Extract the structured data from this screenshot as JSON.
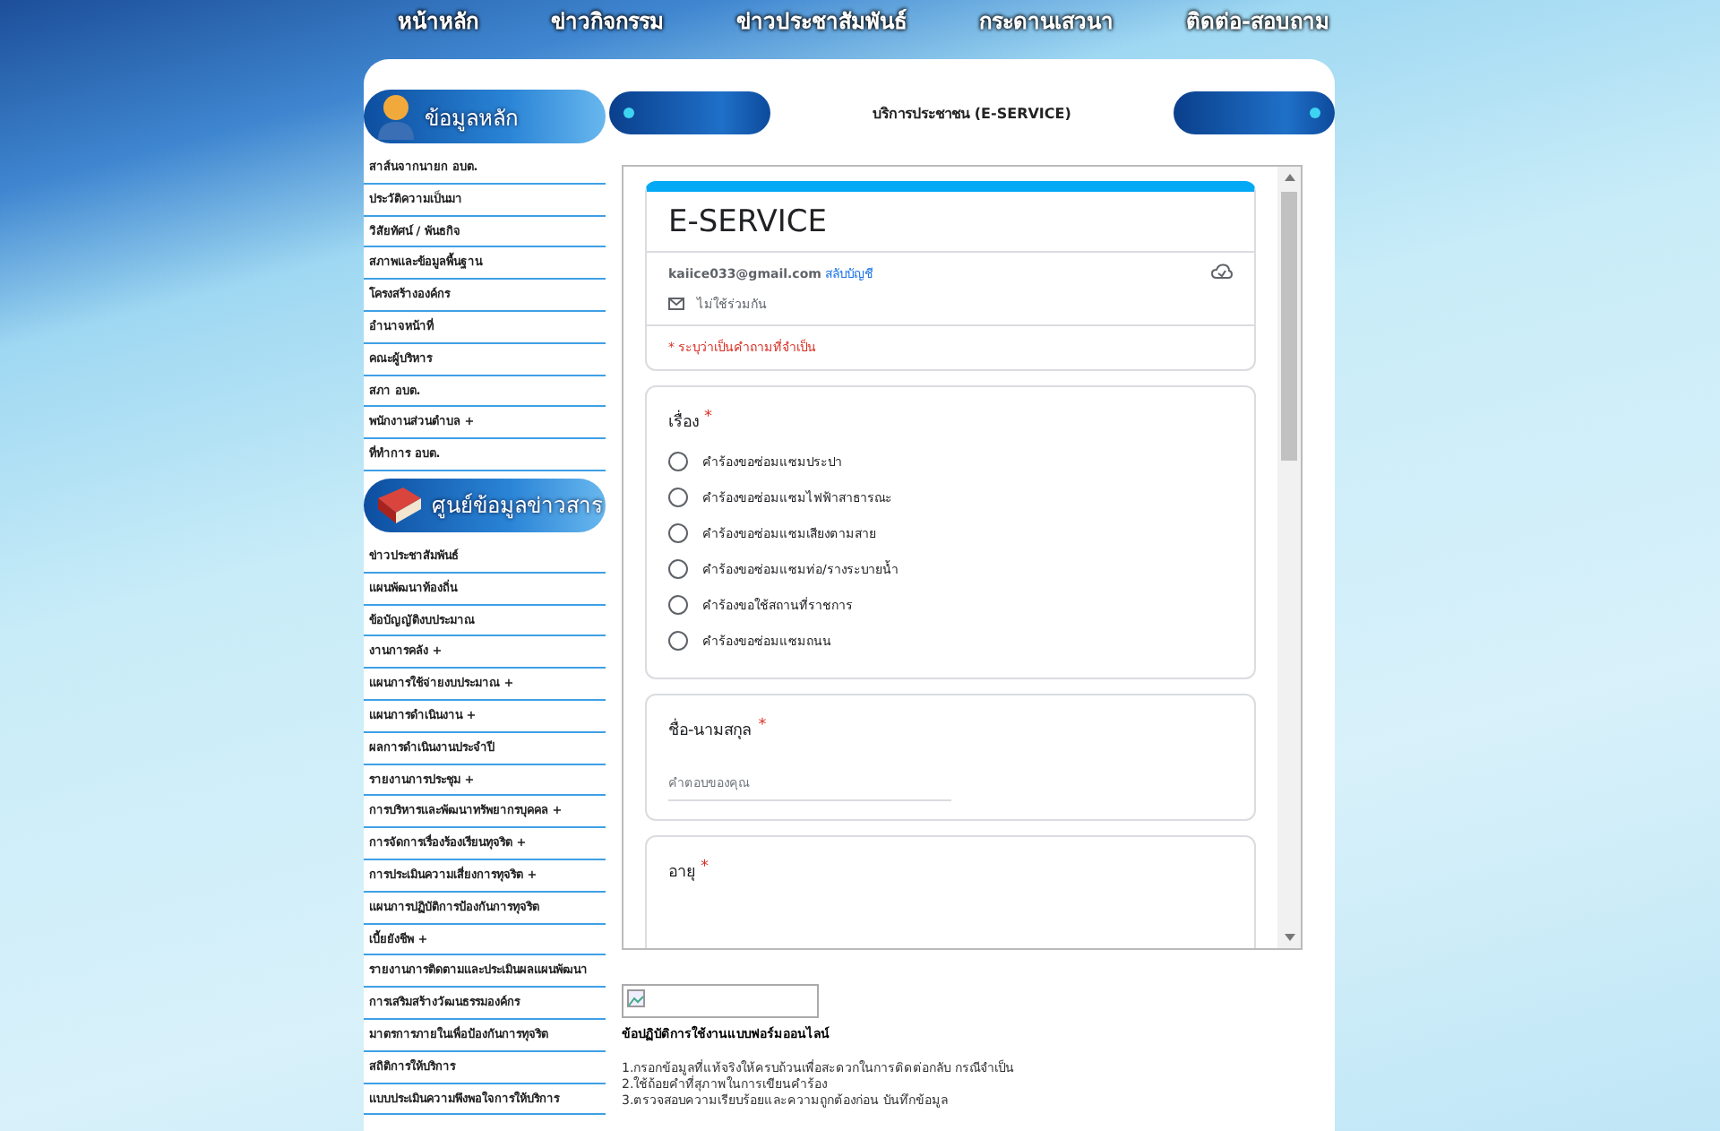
{
  "nav": [
    "หน้าหลัก",
    "ข่าวกิจกรรม",
    "ข่าวประชาสัมพันธ์",
    "กระดานเสวนา",
    "ติดต่อ-สอบถาม"
  ],
  "sidebar": {
    "sections": [
      {
        "title": "ข้อมูลหลัก",
        "kind": "person",
        "items": [
          "สาส์นจากนายก อบต.",
          "ประวัติความเป็นมา",
          "วิสัยทัศน์ / พันธกิจ",
          "สภาพและข้อมูลพื้นฐาน",
          "โครงสร้างองค์กร",
          "อำนาจหน้าที่",
          "คณะผู้บริหาร",
          "สภา อบต.",
          "พนักงานส่วนตำบล +",
          "ที่ทำการ อบต."
        ]
      },
      {
        "title": "ศูนย์ข้อมูลข่าวสาร",
        "kind": "book",
        "items": [
          "ข่าวประชาสัมพันธ์",
          "แผนพัฒนาท้องถิ่น",
          "ข้อบัญญัติงบประมาณ",
          "งานการคลัง +",
          "แผนการใช้จ่ายงบประมาณ +",
          "แผนการดำเนินงาน +",
          "ผลการดำเนินงานประจำปี",
          "รายงานการประชุม +",
          "การบริหารและพัฒนาทรัพยากรบุคคล +",
          "การจัดการเรื่องร้องเรียนทุจริต +",
          "การประเมินความเสี่ยงการทุจริต +",
          "แผนการปฏิบัติการป้องกันการทุจริต",
          "เบี้ยยังชีพ +",
          "รายงานการติดตามและประเมินผลแผนพัฒนา",
          "การเสริมสร้างวัฒนธรรมองค์กร",
          "มาตรการภายในเพื่อป้องกันการทุจริต",
          "สถิติการให้บริการ",
          "แบบประเมินความพึงพอใจการให้บริการ"
        ]
      }
    ]
  },
  "banner": {
    "title": "บริการประชาชน (E-SERVICE)"
  },
  "form": {
    "title": "E-SERVICE",
    "account": {
      "email": "kaiice033@gmail.com",
      "switch_link": "สลับบัญชี",
      "not_shared": "ไม่ใช้ร่วมกัน"
    },
    "required_note": "* ระบุว่าเป็นคำถามที่จำเป็น",
    "questions": [
      {
        "kind": "radio",
        "label": "เรื่อง",
        "mark": "*",
        "options": [
          {
            "label": "คำร้องขอซ่อมแซมประปา",
            "selected": false
          },
          {
            "label": "คำร้องขอซ่อมแซมไฟฟ้าสาธารณะ",
            "selected": false
          },
          {
            "label": "คำร้องขอซ่อมแซมเสียงตามสาย",
            "selected": false
          },
          {
            "label": "คำร้องขอซ่อมแซมท่อ/รางระบายน้ำ",
            "selected": false
          },
          {
            "label": "คำร้องขอใช้สถานที่ราชการ",
            "selected": false
          },
          {
            "label": "คำร้องขอซ่อมแซมถนน",
            "selected": false
          }
        ]
      },
      {
        "kind": "text",
        "label": "ชื่อ-นามสกุล",
        "mark": "*",
        "placeholder": "คำตอบของคุณ"
      },
      {
        "kind": "text",
        "label": "อายุ",
        "mark": "*"
      }
    ]
  },
  "instructions": {
    "title": "ข้อปฏิบัติการใช้งานแบบฟอร์มออนไลน์",
    "lines": [
      "1.กรอกข้อมูลที่แท้จริงให้ครบถ้วนเพื่อสะดวกในการติดต่อกลับ กรณีจำเป็น",
      "2.ใช้ถ้อยคำที่สุภาพในการเขียนคำร้อง",
      "3.ตรวจสอบความเรียบร้อยและความถูกต้องก่อน บันทึกข้อมูล"
    ]
  }
}
